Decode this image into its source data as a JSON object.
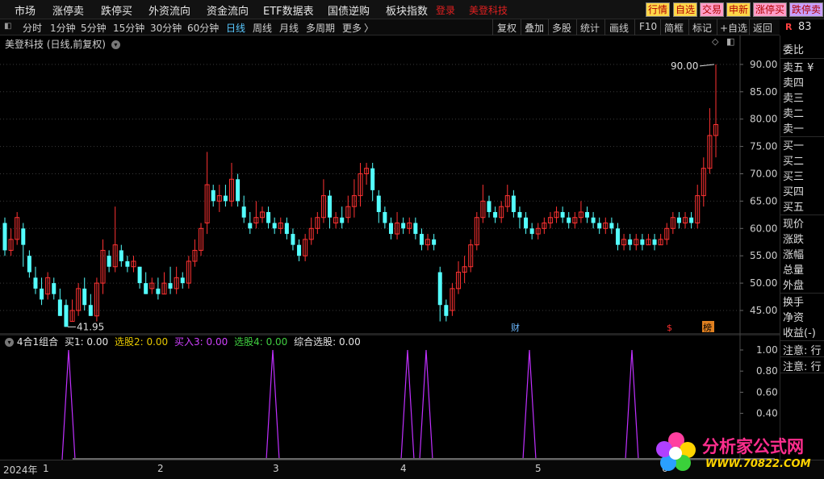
{
  "menu": {
    "items": [
      "市场",
      "涨停卖",
      "跌停买",
      "外资流向",
      "资金流向",
      "ETF数据表",
      "国债逆购",
      "板块指数"
    ],
    "login": "登录",
    "stock_name": "美登科技",
    "quick_buttons": [
      {
        "label": "行情",
        "bg": "#ffd84a",
        "fg": "#b00000"
      },
      {
        "label": "自选",
        "bg": "#ffd84a",
        "fg": "#b00000"
      },
      {
        "label": "交易",
        "bg": "#ff9ec8",
        "fg": "#b00000"
      },
      {
        "label": "申新",
        "bg": "#ffd84a",
        "fg": "#b00000"
      },
      {
        "label": "涨停买",
        "bg": "#ff9ec8",
        "fg": "#b00000"
      },
      {
        "label": "跌停卖",
        "bg": "#c8a0ff",
        "fg": "#b00000"
      }
    ]
  },
  "toolbar": {
    "periods": [
      "分时",
      "1分钟",
      "5分钟",
      "15分钟",
      "30分钟",
      "60分钟",
      "日线",
      "周线",
      "月线",
      "多周期",
      "更多"
    ],
    "active": "日线",
    "more_arrow": "〉",
    "right_items": [
      "复权",
      "叠加",
      "多股",
      "统计",
      "画线",
      "F10",
      "简框",
      "标记",
      "+自选",
      "返回"
    ]
  },
  "chart": {
    "title": "美登科技 (日线,前复权)",
    "price_ticks": [
      "90.00",
      "85.00",
      "80.00",
      "75.00",
      "70.00",
      "65.00",
      "60.00",
      "55.00",
      "50.00",
      "45.00"
    ],
    "high_label": "90.00",
    "low_label": "41.95",
    "markers": {
      "cai": "财",
      "dollar": "$",
      "bang": "榜"
    },
    "up_color": "#ff3232",
    "down_color": "#54ffff"
  },
  "indicator": {
    "name": "4合1组合",
    "items": [
      {
        "label": "买1: 0.00",
        "color": "#e6e6e6"
      },
      {
        "label": "选股2: 0.00",
        "color": "#e6c800"
      },
      {
        "label": "买入3: 0.00",
        "color": "#d040ff"
      },
      {
        "label": "选股4: 0.00",
        "color": "#40d040"
      },
      {
        "label": "综合选股: 0.00",
        "color": "#e6e6e6"
      }
    ],
    "ticks": [
      "1.00",
      "0.80",
      "0.60",
      "0.40"
    ],
    "line_color": "#c030ff"
  },
  "right_panel": {
    "top_badge": "R",
    "top_num": "83",
    "items": [
      "委比",
      "卖五 ¥",
      "卖四",
      "卖三",
      "卖二",
      "卖一",
      "买一",
      "买二",
      "买三",
      "买四",
      "买五",
      "现价",
      "涨跌",
      "涨幅",
      "总量",
      "外盘",
      "换手",
      "净资",
      "收益(-)",
      "注意: 行",
      "注意: 行"
    ]
  },
  "timeline": {
    "year": "2024年",
    "months": [
      "1",
      "2",
      "3",
      "4",
      "5",
      "6"
    ]
  },
  "watermark": {
    "text": "分析家公式网",
    "url": "WWW.70822.COM"
  }
}
